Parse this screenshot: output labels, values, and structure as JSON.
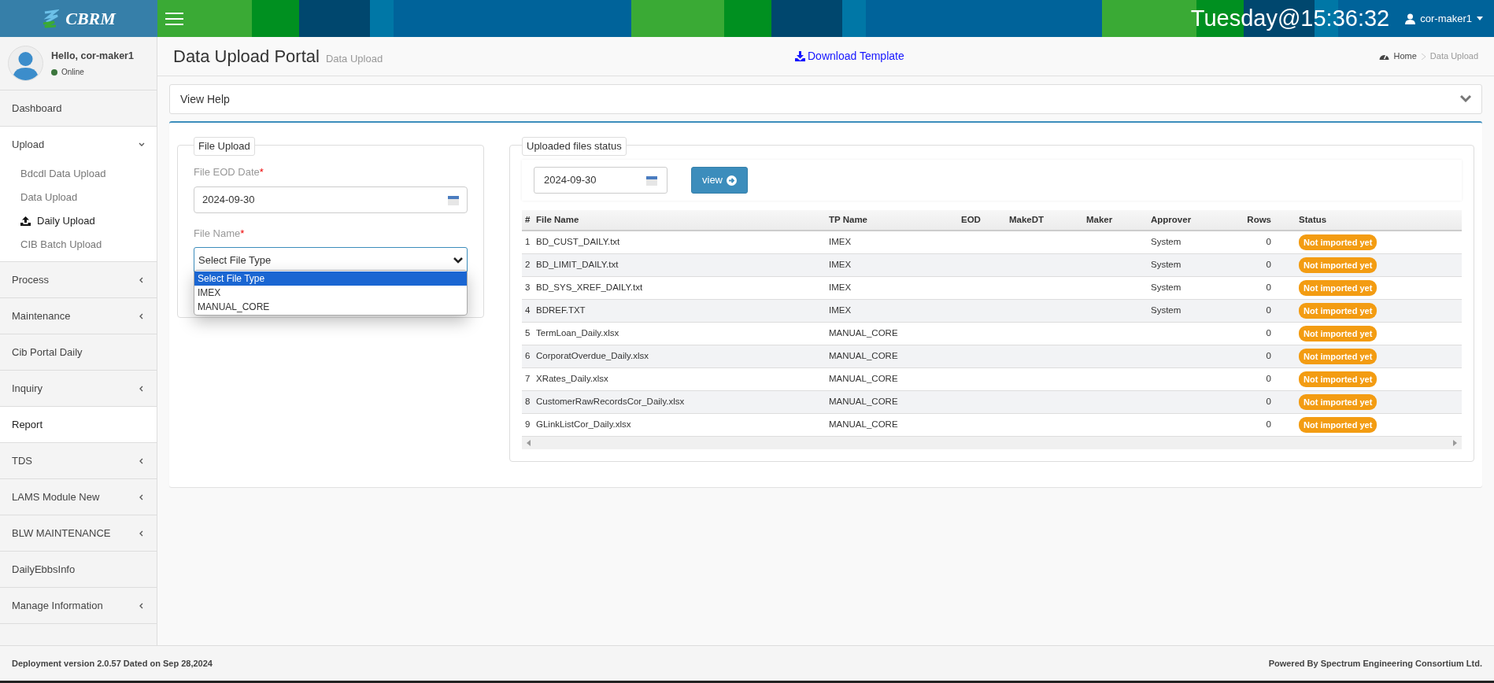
{
  "app": {
    "logo": "CBRM",
    "clock": "Tuesday@15:36:32",
    "user": "cor-maker1"
  },
  "sidebar": {
    "greeting": "Hello, cor-maker1",
    "status": "Online",
    "items": [
      {
        "label": "Dashboard",
        "selected": false
      },
      {
        "label": "Upload",
        "selected": false,
        "expanded": true,
        "children": [
          {
            "label": "Bdcdl Data Upload",
            "selected": false
          },
          {
            "label": "Data Upload",
            "selected": false
          },
          {
            "label": "Daily Upload",
            "selected": true
          },
          {
            "label": "CIB Batch Upload",
            "selected": false
          }
        ]
      },
      {
        "label": "Process",
        "selected": false,
        "expanded": false
      },
      {
        "label": "Maintenance",
        "selected": false,
        "expanded": false
      },
      {
        "label": "Cib Portal Daily",
        "selected": false
      },
      {
        "label": "Inquiry",
        "selected": false,
        "expanded": false
      },
      {
        "label": "Report",
        "selected": true
      },
      {
        "label": "TDS",
        "selected": false,
        "expanded": false
      },
      {
        "label": "LAMS Module New",
        "selected": false,
        "expanded": false
      },
      {
        "label": "BLW MAINTENANCE",
        "selected": false,
        "expanded": false
      },
      {
        "label": "DailyEbbsInfo",
        "selected": false
      },
      {
        "label": "Manage Information",
        "selected": false,
        "expanded": false
      }
    ]
  },
  "page": {
    "title": "Data Upload Portal",
    "subtitle": "Data Upload",
    "download": "Download Template",
    "breadcrumb": [
      "Home",
      "Data Upload"
    ],
    "help": {
      "label": "View Help",
      "expanded": false
    }
  },
  "file_upload": {
    "legend": "File Upload",
    "date_label": "File EOD Date",
    "date_value": "2024-09-30",
    "name_label": "File Name",
    "select_value": "Select File Type",
    "required_mark": "*",
    "options": [
      {
        "label": "Select File Type",
        "selected": true
      },
      {
        "label": "IMEX",
        "selected": false
      },
      {
        "label": "MANUAL_CORE",
        "selected": false
      }
    ]
  },
  "status_panel": {
    "legend": "Uploaded files status",
    "date_value": "2024-09-30",
    "view_button": "view",
    "table": {
      "columns": [
        "#",
        "File Name",
        "TP Name",
        "EOD",
        "MakeDT",
        "Maker",
        "Approver",
        "Rows",
        "Status"
      ],
      "rows": [
        {
          "no": "1",
          "file": "BD_CUST_DAILY.txt",
          "tp": "IMEX",
          "approver": "System",
          "rows": "0",
          "status": "Not imported yet",
          "color": "#f39c12"
        },
        {
          "no": "2",
          "file": "BD_LIMIT_DAILY.txt",
          "tp": "IMEX",
          "approver": "System",
          "rows": "0",
          "status": "Not imported yet",
          "color": "#f39c12"
        },
        {
          "no": "3",
          "file": "BD_SYS_XREF_DAILY.txt",
          "tp": "IMEX",
          "approver": "System",
          "rows": "0",
          "status": "Not imported yet",
          "color": "#f39c12"
        },
        {
          "no": "4",
          "file": "BDREF.TXT",
          "tp": "IMEX",
          "approver": "System",
          "rows": "0",
          "status": "Not imported yet",
          "color": "#f39c12"
        },
        {
          "no": "5",
          "file": "TermLoan_Daily.xlsx",
          "tp": "MANUAL_CORE",
          "rows": "0",
          "status": "Not imported yet",
          "color": "#f39c12"
        },
        {
          "no": "6",
          "file": "CorporatOverdue_Daily.xlsx",
          "tp": "MANUAL_CORE",
          "rows": "0",
          "status": "Not imported yet",
          "color": "#f39c12"
        },
        {
          "no": "7",
          "file": "XRates_Daily.xlsx",
          "tp": "MANUAL_CORE",
          "rows": "0",
          "status": "Not imported yet",
          "color": "#f39c12"
        },
        {
          "no": "8",
          "file": "CustomerRawRecordsCor_Daily.xlsx",
          "tp": "MANUAL_CORE",
          "rows": "0",
          "status": "Not imported yet",
          "color": "#f39c12"
        },
        {
          "no": "9",
          "file": "GLinkListCor_Daily.xlsx",
          "tp": "MANUAL_CORE",
          "rows": "0",
          "status": "Not imported yet",
          "color": "#f39c12"
        }
      ]
    }
  },
  "footer": {
    "left": "Deployment version 2.0.57 Dated on Sep 28,2024",
    "right": "Powered By Spectrum Engineering Consortium Ltd."
  }
}
